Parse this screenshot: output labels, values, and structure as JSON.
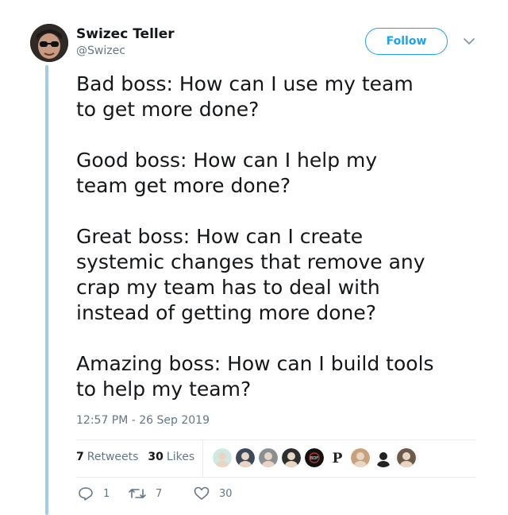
{
  "author": {
    "name": "Swizec Teller",
    "handle": "@Swizec"
  },
  "follow_label": "Follow",
  "tweet": {
    "text": "Bad boss: How can I use my team\nto get more done?\n\nGood boss: How can I help my\nteam get more done?\n\nGreat boss: How can I create\nsystemic changes that remove any\ncrap my team has to deal with\ninstead of getting more done?\n\nAmazing boss: How can I build tools\nto help my team?",
    "timestamp": "12:57 PM - 26 Sep 2019"
  },
  "stats": {
    "retweets_count": "7",
    "retweets_label": "Retweets",
    "likes_count": "30",
    "likes_label": "Likes"
  },
  "likers": [
    {
      "name": "liker-avatar-1",
      "color": "#cfe8e0"
    },
    {
      "name": "liker-avatar-2",
      "color": "#3b4a5a"
    },
    {
      "name": "liker-avatar-3",
      "color": "#8a8f94"
    },
    {
      "name": "liker-avatar-4",
      "color": "#2d2d2d"
    },
    {
      "name": "liker-avatar-5",
      "color": "#111111",
      "label": "BDF"
    },
    {
      "name": "liker-avatar-6",
      "color": "#ffffff",
      "label": "P"
    },
    {
      "name": "liker-avatar-7",
      "color": "#c9a27c"
    },
    {
      "name": "liker-avatar-8",
      "color": "#ffffff"
    },
    {
      "name": "liker-avatar-9",
      "color": "#6b5a4a"
    }
  ],
  "actions": {
    "replies": "1",
    "retweets": "7",
    "likes": "30"
  },
  "colors": {
    "accent": "#1da1f2",
    "thread_line": "#a4cde2",
    "muted": "#657786"
  }
}
